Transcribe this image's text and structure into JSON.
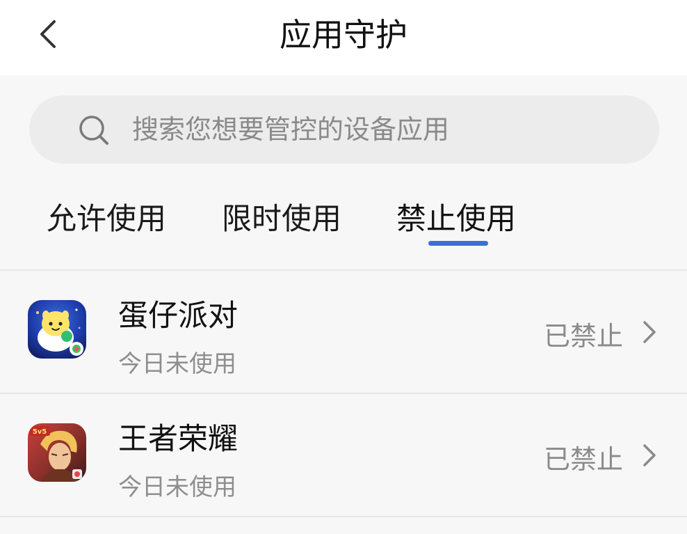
{
  "header": {
    "title": "应用守护",
    "back_icon": "chevron-left-icon"
  },
  "search": {
    "placeholder": "搜索您想要管控的设备应用",
    "value": "",
    "icon": "search-icon"
  },
  "tabs": [
    {
      "label": "允许使用",
      "active": false
    },
    {
      "label": "限时使用",
      "active": false
    },
    {
      "label": "禁止使用",
      "active": true
    }
  ],
  "colors": {
    "accent": "#3b6fd8",
    "background": "#f7f7f7",
    "search_bg": "#ececec",
    "primary_text": "#111111",
    "secondary_text": "#8e8e8e"
  },
  "apps": [
    {
      "name": "蛋仔派对",
      "usage": "今日未使用",
      "status": "已禁止",
      "icon": "eggy-party-app-icon"
    },
    {
      "name": "王者荣耀",
      "usage": "今日未使用",
      "status": "已禁止",
      "icon": "honor-of-kings-app-icon"
    }
  ]
}
